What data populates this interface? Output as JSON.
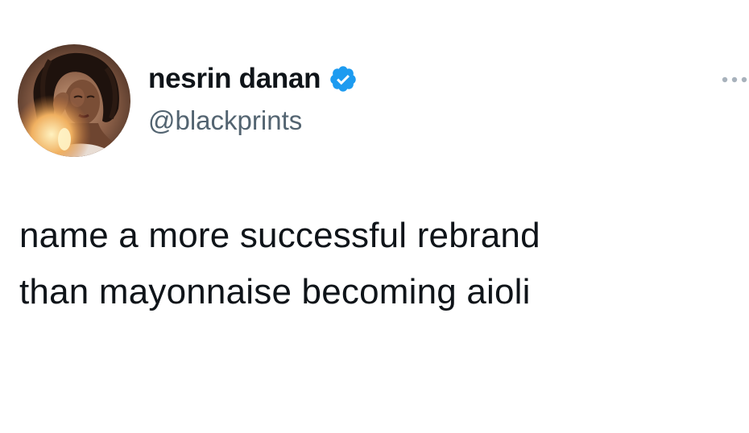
{
  "tweet": {
    "author": {
      "display_name": "nesrin danan",
      "handle": "@blackprints",
      "verified": true,
      "avatar_icon": "user-avatar-photo"
    },
    "text": "name a more successful rebrand\nthan mayonnaise becoming aioli",
    "more_icon": "more-options-icon"
  },
  "colors": {
    "text_primary": "#0f1419",
    "text_secondary": "#536471",
    "verified_blue": "#1d9bf0",
    "background": "#ffffff"
  }
}
